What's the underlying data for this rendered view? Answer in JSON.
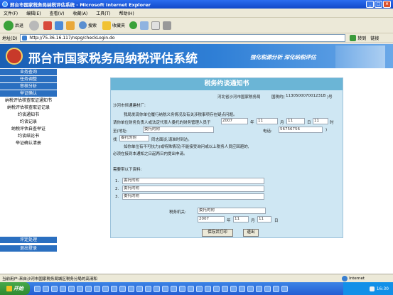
{
  "window": {
    "title": "邢台市国家税务局纳税评估系统 - Microsoft Internet Explorer"
  },
  "menu": [
    "文件(F)",
    "编辑(E)",
    "查看(V)",
    "收藏(A)",
    "工具(T)",
    "帮助(H)"
  ],
  "toolbar": {
    "back": "后退",
    "search": "搜索",
    "favorites": "收藏夹"
  },
  "address": {
    "label": "地址(D)",
    "url": "http://75.36.16.117/nspg/checkLogin.do",
    "go": "转到",
    "links": "链接"
  },
  "banner": {
    "title": "邢台市国家税务局纳税评估系统",
    "slogan": "强化税源分析 深化纳税评估"
  },
  "sidebar": {
    "top": [
      "业务查询",
      "任务调整",
      "审核分析",
      "举证确认"
    ],
    "sub": [
      "纳税评估核查取证通知书",
      "纳税评估核查取证记录",
      "约谈通知书",
      "约谈记录",
      "纳税评估自查举证",
      "约谈结论书",
      "举证确认清册"
    ],
    "bottom": [
      "评定处理",
      "退出登录"
    ]
  },
  "notice": {
    "title": "税务约谈通知书",
    "org_line": "河北省沙河市国家税务局",
    "doc_label": "国税约(",
    "doc_no": "113050007001231B",
    "doc_suffix": ")号",
    "recipient": "沙河市恒通建材厂:",
    "para1": "我局发现你单位履行纳税义务情况及有关涉税事项存在疑点问题。",
    "invite_a": "请你单位财务负责人或法定代表人委托的财务管理人员于",
    "year": "2007",
    "year_unit": "年",
    "month": "11",
    "month_unit": "月",
    "day": "11",
    "day_unit": "日",
    "hour": "11",
    "hour_unit": "时",
    "to_label": "至(地址:",
    "address_val": "委托的附",
    "phone_label": "电话:",
    "phone_val": "56756756",
    "phone_end": ")",
    "find_label": "找",
    "contact_val": "委托的附",
    "find_tail": "同志面谈,请准时到达。",
    "para2": "如你单位有不可抗力(或特殊情况)不能接受询问或以上税务人员应回避的,",
    "para3": "必须在接到本通知之日起两日内提出申请。",
    "materials_label": "需要带以下资料:",
    "items": [
      {
        "no": "1.",
        "val": "委托的附"
      },
      {
        "no": "2.",
        "val": "委托的附"
      },
      {
        "no": "3.",
        "val": "委托的附"
      }
    ],
    "authority_label": "税务机关:",
    "authority_val": "委托的附",
    "sign_year": "2007",
    "sign_month": "11",
    "sign_day": "11",
    "save_print": "保存并打印",
    "exit": "退出"
  },
  "status": {
    "text": "当前用户:来自沙河市国家税务局城区税务分局的高清和",
    "zone": "Internet"
  },
  "taskbar": {
    "start": "开始",
    "time": "16:30"
  },
  "colors": {
    "banner": "#1a5fb4",
    "nav": "#2a6fc0",
    "notice_bg": "#cfe7f3",
    "notice_head": "#6bb5d6"
  }
}
